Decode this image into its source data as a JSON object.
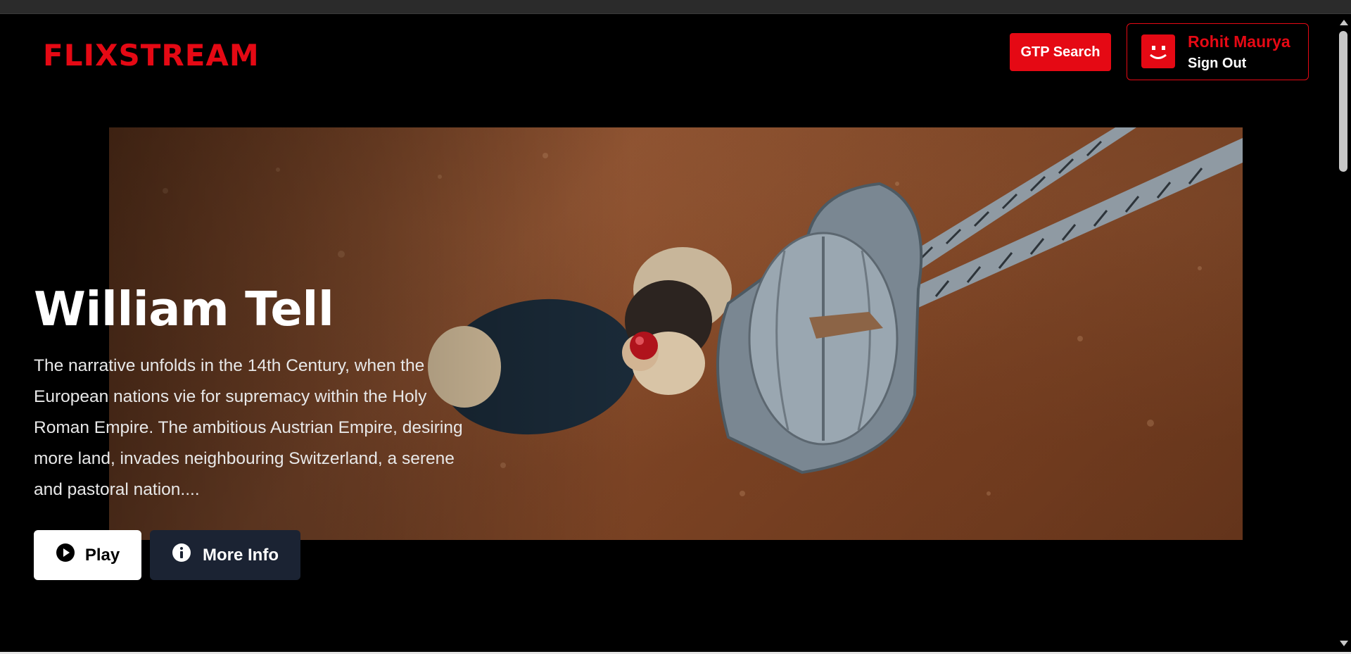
{
  "brand": {
    "logo": "FLIXSTREAM",
    "accent_color": "#e50914"
  },
  "header": {
    "gpt_search_label": "GTP Search",
    "user": {
      "name": "Rohit Maurya",
      "sign_out_label": "Sign Out",
      "avatar_icon": "smiley-avatar-icon"
    }
  },
  "hero": {
    "title": "William Tell",
    "overview": "The narrative unfolds in the 14th Century, when the European nations vie for supremacy within the Holy Roman Empire. The ambitious Austrian Empire, desiring more land, invades neighbouring Switzerland, a serene and pastoral nation....",
    "play_label": "Play",
    "play_icon": "play-circle-icon",
    "more_info_label": "More Info",
    "more_info_icon": "info-circle-icon",
    "backdrop_description_icon": "movie-backdrop-image"
  }
}
